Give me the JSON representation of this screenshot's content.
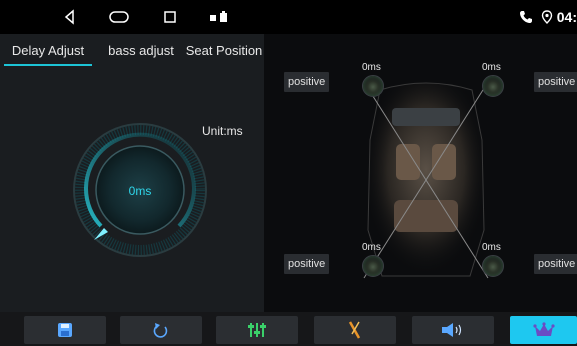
{
  "status_bar": {
    "time": "04:",
    "icons": [
      "back-icon",
      "home-icon",
      "recents-icon",
      "notification-icons",
      "phone-icon",
      "location-icon"
    ]
  },
  "tabs": [
    {
      "label": "Delay Adjust",
      "active": true
    },
    {
      "label": "bass adjust",
      "active": false
    },
    {
      "label": "Seat Position",
      "active": false
    }
  ],
  "unit_label": "Unit:ms",
  "knob": {
    "value": "0ms"
  },
  "speakers": {
    "front_left": {
      "delay": "0ms",
      "phase": "positive"
    },
    "front_right": {
      "delay": "0ms",
      "phase": "positive"
    },
    "rear_left": {
      "delay": "0ms",
      "phase": "positive"
    },
    "rear_right": {
      "delay": "0ms",
      "phase": "positive"
    }
  },
  "bottom_bar": {
    "buttons": [
      {
        "icon": "save-icon",
        "active": false
      },
      {
        "icon": "reset-icon",
        "active": false
      },
      {
        "icon": "equalizer-icon",
        "active": false
      },
      {
        "icon": "instrument-icon",
        "active": false
      },
      {
        "icon": "speaker-volume-icon",
        "active": false
      },
      {
        "icon": "crown-icon",
        "active": true
      }
    ]
  },
  "colors": {
    "accent": "#1dc4d6",
    "active_button": "#1ec8f0",
    "panel": "#1a1d20"
  }
}
